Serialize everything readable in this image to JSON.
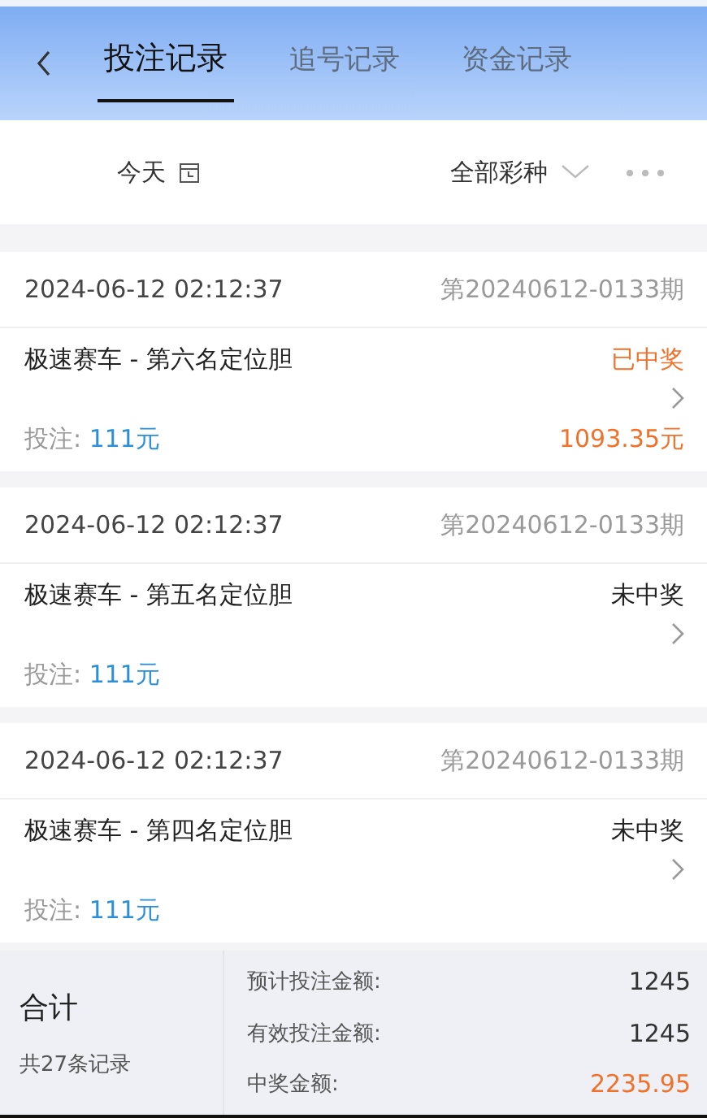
{
  "tabs": [
    {
      "label": "投注记录",
      "selected": true
    },
    {
      "label": "追号记录",
      "selected": false
    },
    {
      "label": "资金记录",
      "selected": false
    }
  ],
  "filters": {
    "date": "今天",
    "lottery": "全部彩种"
  },
  "records": [
    {
      "time": "2024-06-12 02:12:37",
      "issue": "第20240612-0133期",
      "game": "极速赛车 - 第六名定位胆",
      "status": "已中奖",
      "won": true,
      "bet_label": "投注:",
      "bet": "111元",
      "prize": "1093.35元"
    },
    {
      "time": "2024-06-12 02:12:37",
      "issue": "第20240612-0133期",
      "game": "极速赛车 - 第五名定位胆",
      "status": "未中奖",
      "won": false,
      "bet_label": "投注:",
      "bet": "111元"
    },
    {
      "time": "2024-06-12 02:12:37",
      "issue": "第20240612-0133期",
      "game": "极速赛车 - 第四名定位胆",
      "status": "未中奖",
      "won": false,
      "bet_label": "投注:",
      "bet": "111元"
    }
  ],
  "summary": {
    "title": "合计",
    "count": "共27条记录",
    "rows": [
      {
        "label": "预计投注金额:",
        "value": "1245",
        "highlight": false
      },
      {
        "label": "有效投注金额:",
        "value": "1245",
        "highlight": false
      },
      {
        "label": "中奖金额:",
        "value": "2235.95",
        "highlight": true
      }
    ]
  }
}
